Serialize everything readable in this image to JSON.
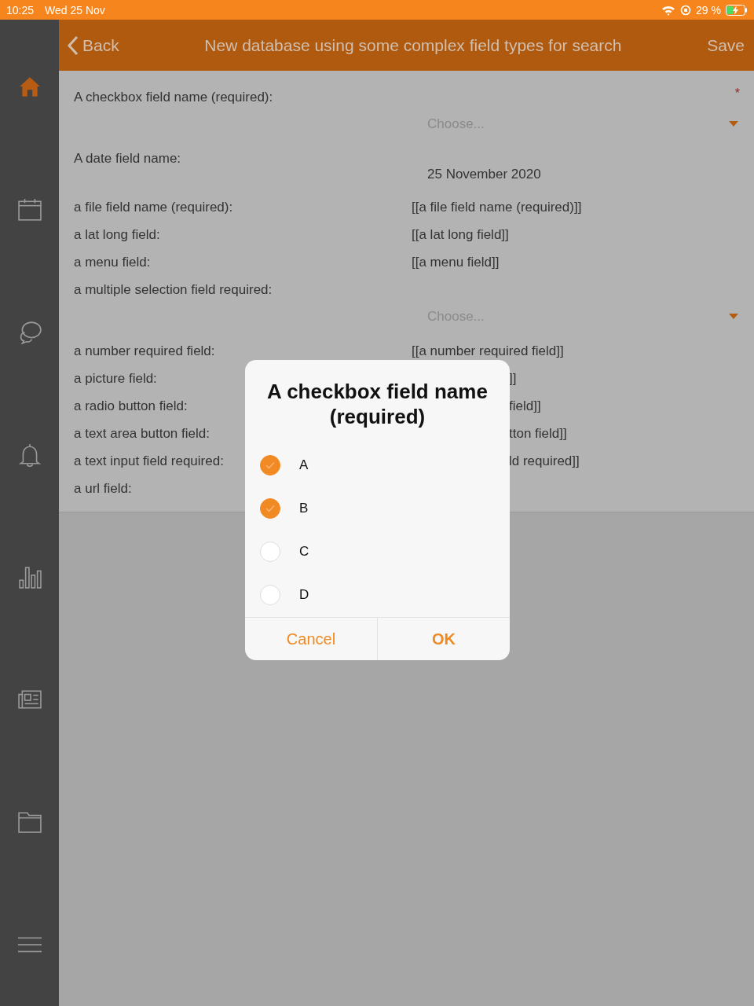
{
  "status_bar": {
    "time": "10:25",
    "date": "Wed 25 Nov",
    "battery": "29 %"
  },
  "sidebar": {
    "items": [
      {
        "kind": "home",
        "selected": true
      },
      {
        "kind": "calendar",
        "selected": false
      },
      {
        "kind": "chat",
        "selected": false
      },
      {
        "kind": "bell",
        "selected": false
      },
      {
        "kind": "chart",
        "selected": false
      },
      {
        "kind": "news",
        "selected": false
      },
      {
        "kind": "folder",
        "selected": false
      },
      {
        "kind": "menu",
        "selected": false
      }
    ]
  },
  "header": {
    "back": "Back",
    "title": "New database using some complex field types for search",
    "save": "Save"
  },
  "form": {
    "rows": [
      {
        "kind": "select",
        "label": "A checkbox field name (required):",
        "placeholder": "Choose...",
        "required": "*"
      },
      {
        "kind": "date",
        "label": "A date field name:",
        "value": "25 November 2020"
      },
      {
        "kind": "text",
        "label": "a file field name (required):",
        "value": "[[a file field name (required)]]"
      },
      {
        "kind": "text",
        "label": "a lat long field:",
        "value": "[[a lat long field]]"
      },
      {
        "kind": "text",
        "label": "a menu field:",
        "value": "[[a menu field]]"
      },
      {
        "kind": "select",
        "label": "a multiple selection field required:",
        "placeholder": "Choose..."
      },
      {
        "kind": "text",
        "label": "a number required field:",
        "value": "[[a number required field]]"
      },
      {
        "kind": "cut",
        "label": "a picture field:",
        "value": "]]"
      },
      {
        "kind": "cut",
        "label": "a radio button field:",
        "value": "field]]"
      },
      {
        "kind": "cut",
        "label": "a text area button field:",
        "value": "tton field]]"
      },
      {
        "kind": "cut",
        "label": "a text input field required:",
        "value": "ld required]]"
      },
      {
        "kind": "text",
        "label": "a url field:"
      }
    ]
  },
  "dialog": {
    "title": "A checkbox field name (required)",
    "options": [
      {
        "label": "A",
        "checked": true
      },
      {
        "label": "B",
        "checked": true
      },
      {
        "label": "C",
        "checked": false
      },
      {
        "label": "D",
        "checked": false
      }
    ],
    "buttons": [
      {
        "label": "Cancel",
        "kind": "cancel"
      },
      {
        "label": "OK",
        "kind": "ok"
      }
    ]
  }
}
